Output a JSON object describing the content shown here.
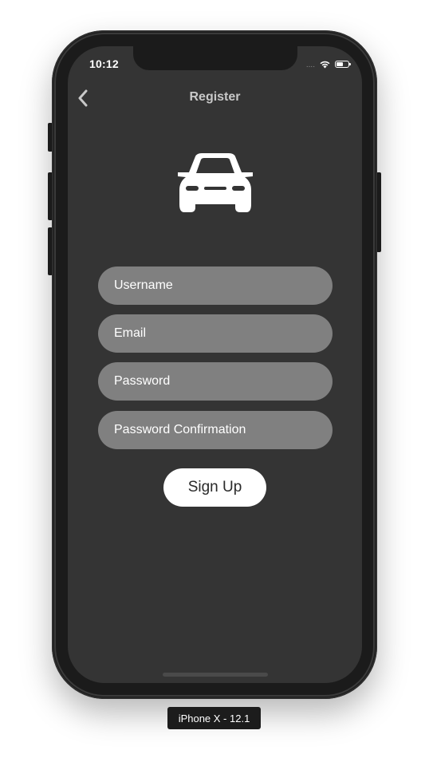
{
  "status_bar": {
    "time": "10:12",
    "signal": "....",
    "icons": [
      "wifi-icon",
      "battery-icon"
    ]
  },
  "nav": {
    "back_icon": "chevron-left-icon",
    "title": "Register"
  },
  "logo": {
    "icon": "car-icon"
  },
  "form": {
    "username_placeholder": "Username",
    "email_placeholder": "Email",
    "password_placeholder": "Password",
    "password_confirmation_placeholder": "Password Confirmation",
    "submit_label": "Sign Up"
  },
  "simulator": {
    "device_label": "iPhone X - 12.1"
  },
  "colors": {
    "screen_background": "#343434",
    "field_background": "#808080",
    "button_background": "#ffffff",
    "title_color": "#c8c8c8"
  }
}
